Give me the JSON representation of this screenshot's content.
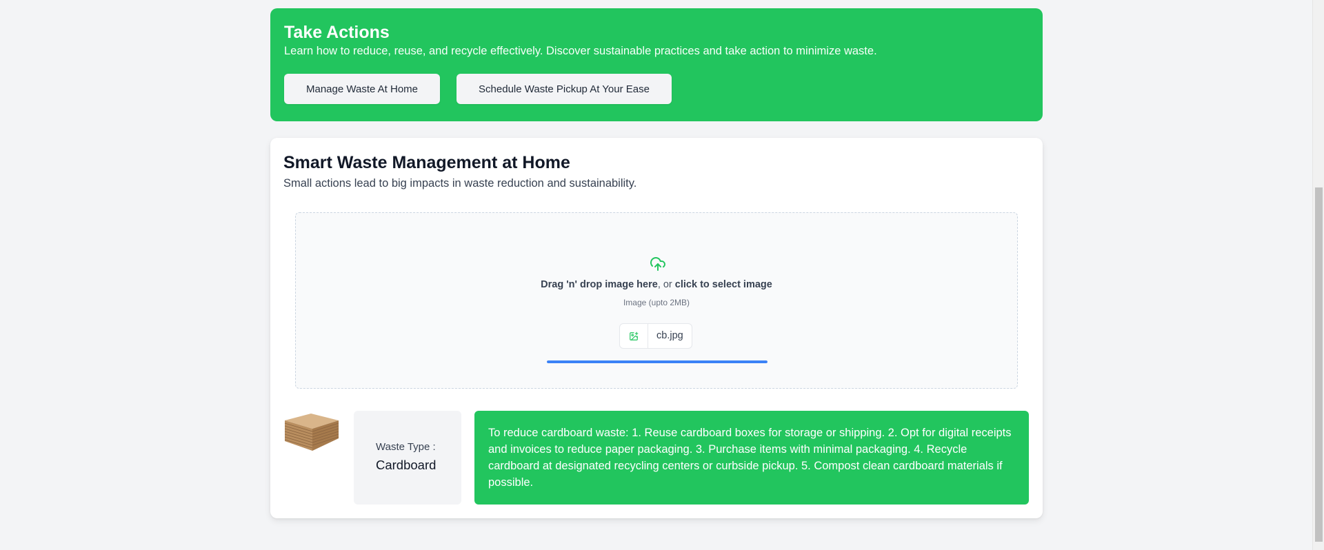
{
  "take_actions": {
    "title": "Take Actions",
    "subtitle": "Learn how to reduce, reuse, and recycle effectively. Discover sustainable practices and take action to minimize waste.",
    "buttons": [
      {
        "label": "Manage Waste At Home"
      },
      {
        "label": "Schedule Waste Pickup At Your Ease"
      }
    ]
  },
  "smart_waste": {
    "title": "Smart Waste Management at Home",
    "subtitle": "Small actions lead to big impacts in waste reduction and sustainability.",
    "dropzone": {
      "icon": "upload-cloud-icon",
      "text_bold_1": "Drag 'n' drop image here",
      "text_plain": ", or ",
      "text_bold_2": "click to select image",
      "hint": "Image (upto 2MB)",
      "file": {
        "icon": "image-plus-icon",
        "name": "cb.jpg"
      },
      "progress": 1.0
    },
    "result": {
      "thumbnail": "cardboard-image",
      "waste_type_label": "Waste Type :",
      "waste_type_value": "Cardboard",
      "tips": "To reduce cardboard waste: 1. Reuse cardboard boxes for storage or shipping. 2. Opt for digital receipts and invoices to reduce paper packaging. 3. Purchase items with minimal packaging. 4. Recycle cardboard at designated recycling centers or curbside pickup. 5. Compost clean cardboard materials if possible."
    }
  },
  "colors": {
    "brand_green": "#22c55e",
    "progress_blue": "#3b82f6",
    "background": "#f3f4f6"
  }
}
